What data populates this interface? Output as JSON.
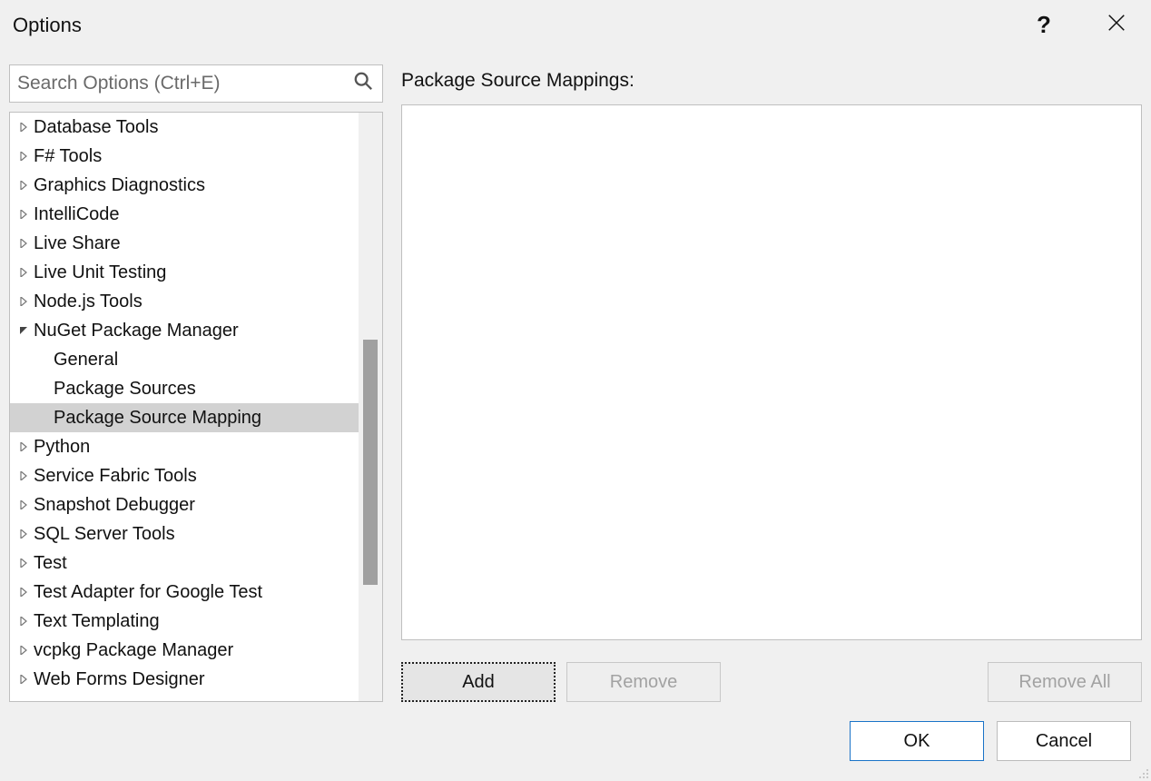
{
  "title": "Options",
  "search": {
    "placeholder": "Search Options (Ctrl+E)"
  },
  "tree": {
    "items": [
      {
        "label": "Database Tools",
        "expanded": false,
        "hasChildren": true
      },
      {
        "label": "F# Tools",
        "expanded": false,
        "hasChildren": true
      },
      {
        "label": "Graphics Diagnostics",
        "expanded": false,
        "hasChildren": true
      },
      {
        "label": "IntelliCode",
        "expanded": false,
        "hasChildren": true
      },
      {
        "label": "Live Share",
        "expanded": false,
        "hasChildren": true
      },
      {
        "label": "Live Unit Testing",
        "expanded": false,
        "hasChildren": true
      },
      {
        "label": "Node.js Tools",
        "expanded": false,
        "hasChildren": true
      },
      {
        "label": "NuGet Package Manager",
        "expanded": true,
        "hasChildren": true,
        "children": [
          {
            "label": "General"
          },
          {
            "label": "Package Sources"
          },
          {
            "label": "Package Source Mapping",
            "selected": true
          }
        ]
      },
      {
        "label": "Python",
        "expanded": false,
        "hasChildren": true
      },
      {
        "label": "Service Fabric Tools",
        "expanded": false,
        "hasChildren": true
      },
      {
        "label": "Snapshot Debugger",
        "expanded": false,
        "hasChildren": true
      },
      {
        "label": "SQL Server Tools",
        "expanded": false,
        "hasChildren": true
      },
      {
        "label": "Test",
        "expanded": false,
        "hasChildren": true
      },
      {
        "label": "Test Adapter for Google Test",
        "expanded": false,
        "hasChildren": true
      },
      {
        "label": "Text Templating",
        "expanded": false,
        "hasChildren": true
      },
      {
        "label": "vcpkg Package Manager",
        "expanded": false,
        "hasChildren": true
      },
      {
        "label": "Web Forms Designer",
        "expanded": false,
        "hasChildren": true
      }
    ]
  },
  "right": {
    "heading": "Package Source Mappings:",
    "buttons": {
      "add": "Add",
      "remove": "Remove",
      "removeAll": "Remove All"
    }
  },
  "footer": {
    "ok": "OK",
    "cancel": "Cancel"
  }
}
